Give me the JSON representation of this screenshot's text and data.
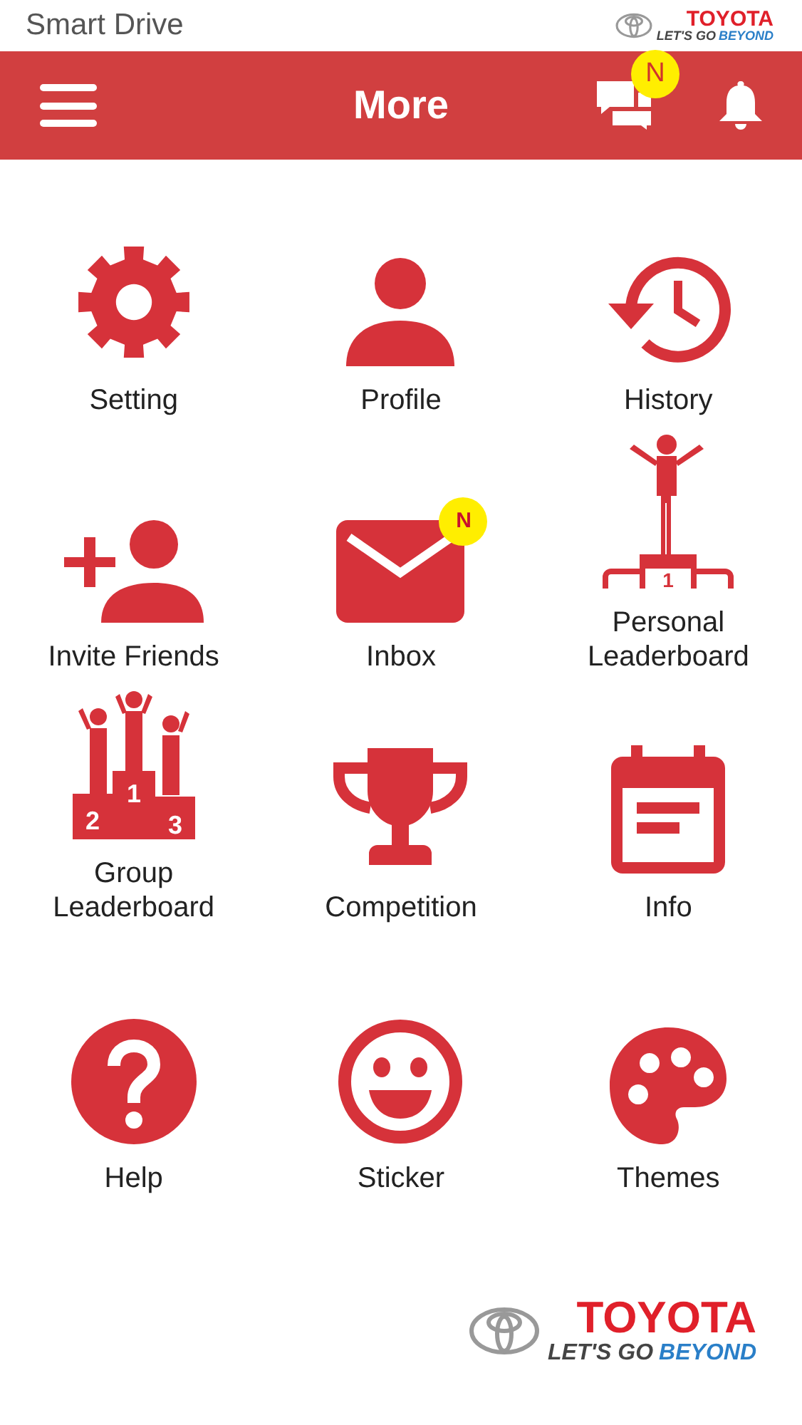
{
  "status_bar": {
    "app_name": "Smart Drive",
    "logo": {
      "brand": "TOYOTA",
      "slogan_start": "LET'S GO",
      "slogan_end": "BEYOND"
    }
  },
  "header": {
    "title": "More",
    "messages_badge": "N"
  },
  "items": [
    {
      "label": "Setting",
      "kind": "gear"
    },
    {
      "label": "Profile",
      "kind": "person"
    },
    {
      "label": "History",
      "kind": "history"
    },
    {
      "label": "Invite Friends",
      "kind": "addperson"
    },
    {
      "label": "Inbox",
      "kind": "mail",
      "badge": "N"
    },
    {
      "label": "Personal Leaderboard",
      "kind": "podium",
      "icon_labels": [
        "1"
      ]
    },
    {
      "label": "Group Leaderboard",
      "kind": "podiums",
      "icon_labels": [
        "2",
        "1",
        "3"
      ]
    },
    {
      "label": "Competition",
      "kind": "trophy"
    },
    {
      "label": "Info",
      "kind": "calendar"
    },
    {
      "label": "Help",
      "kind": "help"
    },
    {
      "label": "Sticker",
      "kind": "smiley"
    },
    {
      "label": "Themes",
      "kind": "palette"
    }
  ],
  "footer_logo": {
    "brand": "TOYOTA",
    "slogan_start": "LET'S GO",
    "slogan_end": "BEYOND"
  }
}
